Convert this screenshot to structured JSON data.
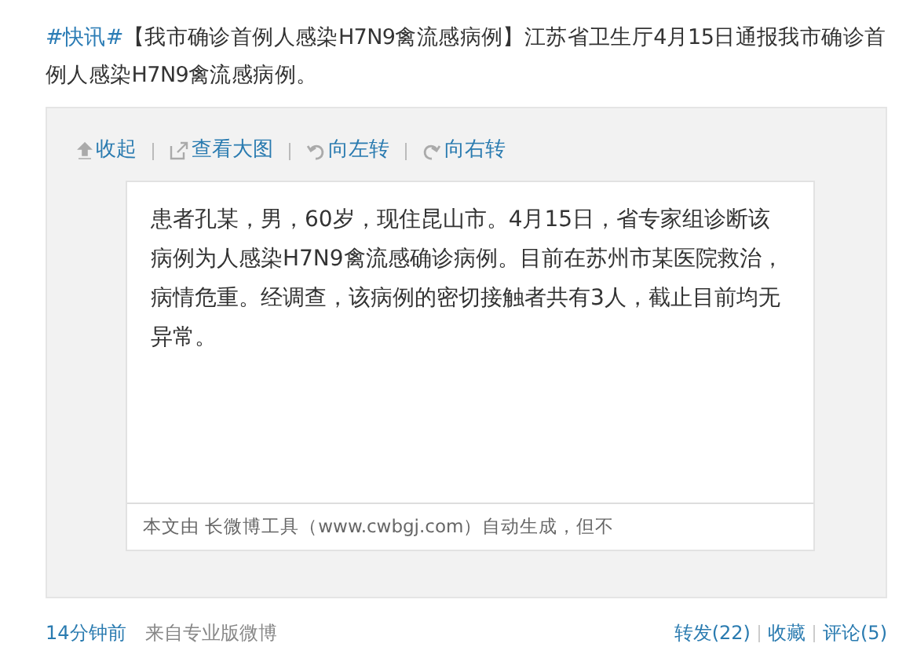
{
  "post": {
    "topic": "#快讯#",
    "text": "【我市确诊首例人感染H7N9禽流感病例】江苏省卫生厅4月15日通报我市确诊首例人感染H7N9禽流感病例。"
  },
  "toolbar": [
    {
      "kind": "collapse",
      "label": "收起"
    },
    {
      "kind": "view",
      "label": "查看大图"
    },
    {
      "kind": "left",
      "label": "向左转"
    },
    {
      "kind": "right",
      "label": "向右转"
    }
  ],
  "image": {
    "body": "患者孔某，男，60岁，现住昆山市。4月15日，省专家组诊断该病例为人感染H7N9禽流感确诊病例。目前在苏州市某医院救治，病情危重。经调查，该病例的密切接触者共有3人，截止目前均无异常。",
    "footer": "本文由 长微博工具（www.cwbgj.com）自动生成，但不"
  },
  "meta": {
    "time": "14分钟前",
    "source": "来自专业版微博"
  },
  "actions": [
    "转发(22)",
    "收藏",
    "评论(5)"
  ]
}
